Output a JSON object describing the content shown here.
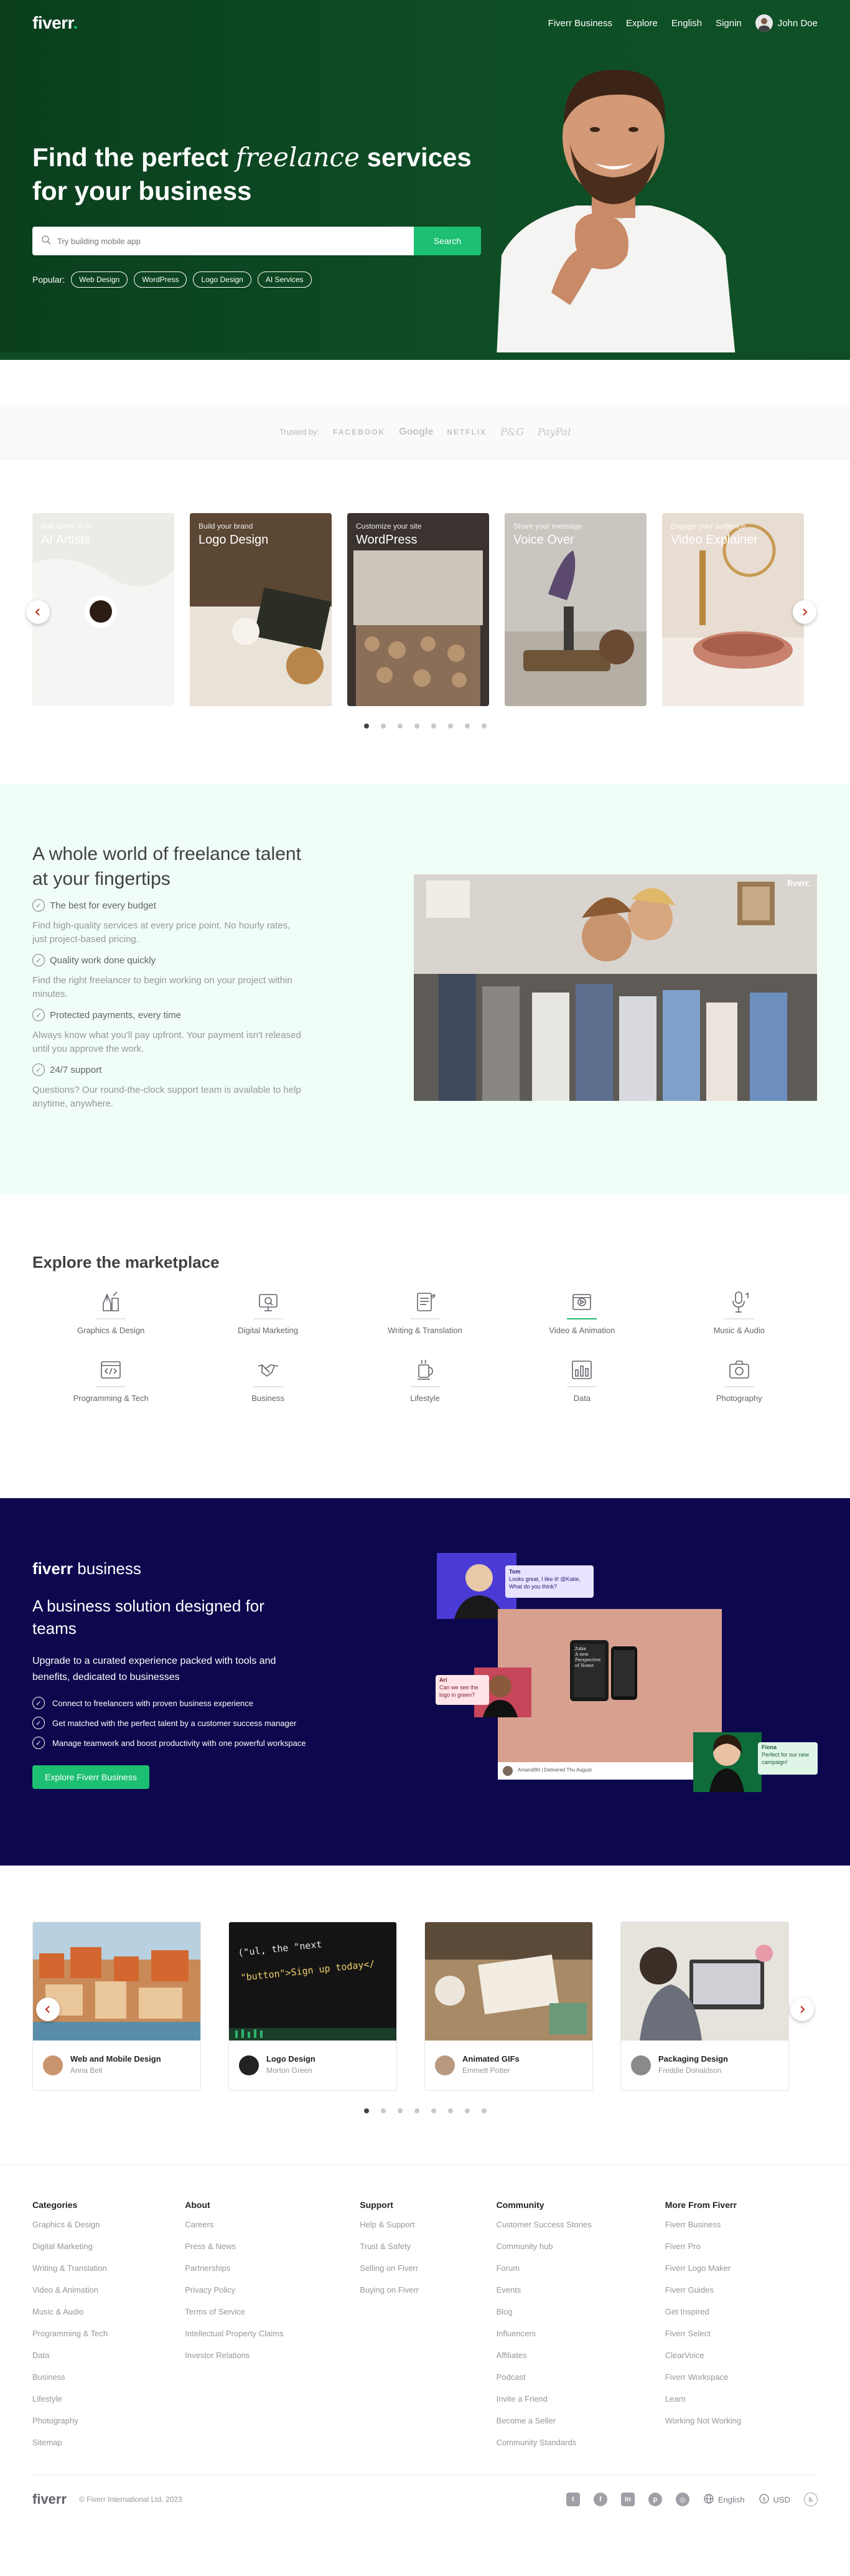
{
  "nav": {
    "logo": "fiverr",
    "logo_dot": ".",
    "links": [
      "Fiverr Business",
      "Explore",
      "English",
      "Signin"
    ],
    "user_name": "John Doe"
  },
  "hero": {
    "title_part1": "Find the perfect ",
    "title_italic": "freelance",
    "title_part2": " services for your business",
    "search_placeholder": "Try building mobile app",
    "search_button": "Search",
    "popular_label": "Popular:",
    "popular_tags": [
      "Web Design",
      "WordPress",
      "Logo Design",
      "AI Services"
    ]
  },
  "trusted": {
    "label": "Trusted by:",
    "brands": [
      "FACEBOOK",
      "Google",
      "NETFLIX",
      "P&G",
      "PayPal"
    ]
  },
  "services": {
    "cards": [
      {
        "sub": "Add talent to AI",
        "title": "AI Artists",
        "tone": "#e9e7e3"
      },
      {
        "sub": "Build your brand",
        "title": "Logo Design",
        "tone": "#8a6a4a"
      },
      {
        "sub": "Customize your site",
        "title": "WordPress",
        "tone": "#5b4a3e"
      },
      {
        "sub": "Share your message",
        "title": "Voice Over",
        "tone": "#bdb8b0"
      },
      {
        "sub": "Engage your audience",
        "title": "Video Explainer",
        "tone": "#d89a84"
      }
    ],
    "dots": 8,
    "active_dot": 0
  },
  "selling": {
    "title": "A whole world of freelance talent at your fingertips",
    "items": [
      {
        "title": "The best for every budget",
        "text": "Find high-quality services at every price point. No hourly rates, just project-based pricing."
      },
      {
        "title": "Quality work done quickly",
        "text": "Find the right freelancer to begin working on your project within minutes."
      },
      {
        "title": "Protected payments, every time",
        "text": "Always know what you'll pay upfront. Your payment isn't released until you approve the work."
      },
      {
        "title": "24/7 support",
        "text": "Questions? Our round-the-clock support team is available to help anytime, anywhere."
      }
    ],
    "video_logo": "fiverr."
  },
  "market": {
    "title": "Explore the marketplace",
    "items": [
      {
        "label": "Graphics & Design",
        "icon": "pen-tool-icon"
      },
      {
        "label": "Digital Marketing",
        "icon": "monitor-icon"
      },
      {
        "label": "Writing & Translation",
        "icon": "document-icon"
      },
      {
        "label": "Video & Animation",
        "icon": "film-icon"
      },
      {
        "label": "Music & Audio",
        "icon": "microphone-icon"
      },
      {
        "label": "Programming & Tech",
        "icon": "code-window-icon"
      },
      {
        "label": "Business",
        "icon": "handshake-icon"
      },
      {
        "label": "Lifestyle",
        "icon": "coffee-cup-icon"
      },
      {
        "label": "Data",
        "icon": "chart-icon"
      },
      {
        "label": "Photography",
        "icon": "camera-icon"
      }
    ],
    "active_index": 3
  },
  "business": {
    "brand": "fiverr",
    "brand_suffix": " business",
    "title": "A business solution designed for teams",
    "lead": "Upgrade to a curated experience packed with tools and benefits, dedicated to businesses",
    "items": [
      "Connect to freelancers with proven business experience",
      "Get matched with the perfect talent by a customer success manager",
      "Manage teamwork and boost productivity with one powerful workspace"
    ],
    "button": "Explore Fiverr Business",
    "bubble1": "Looks great, I like it! @Katie, What do you think?",
    "bubble1_name": "Tom",
    "bubble2": "Can we see the logo in green?",
    "bubble2_name": "Ari",
    "bubble3": "Perfect for our new campaign!",
    "bubble3_name": "Fiona",
    "mockup_title": "A new Perspective of Home",
    "mockup_brand": "Zubia",
    "mockup_footer": "Amandi90 | Delivered Thu August"
  },
  "projects": {
    "cards": [
      {
        "title": "Web and Mobile Design",
        "author": "Anna Bell",
        "tone": "#c06c3a"
      },
      {
        "title": "Logo Design",
        "author": "Morton Green",
        "tone": "#1a1a1a"
      },
      {
        "title": "Animated GIFs",
        "author": "Emmett Potter",
        "tone": "#8a6f52"
      },
      {
        "title": "Packaging Design",
        "author": "Freddie Donaldson",
        "tone": "#d8d3cc"
      }
    ],
    "code_line1": "(\"ul, the \"next",
    "code_line2": "\"button\">Sign up today</",
    "dots": 8,
    "active_dot": 0
  },
  "footer": {
    "columns": [
      {
        "title": "Categories",
        "links": [
          "Graphics & Design",
          "Digital Marketing",
          "Writing & Translation",
          "Video & Animation",
          "Music & Audio",
          "Programming & Tech",
          "Data",
          "Business",
          "Lifestyle",
          "Photography",
          "Sitemap"
        ]
      },
      {
        "title": "About",
        "links": [
          "Careers",
          "Press & News",
          "Partnerships",
          "Privacy Policy",
          "Terms of Service",
          "Intellectual Property Claims",
          "Investor Relations"
        ]
      },
      {
        "title": "Support",
        "links": [
          "Help & Support",
          "Trust & Safety",
          "Selling on Fiverr",
          "Buying on Fiverr"
        ]
      },
      {
        "title": "Community",
        "links": [
          "Customer Success Stories",
          "Community hub",
          "Forum",
          "Events",
          "Blog",
          "Influencers",
          "Affiliates",
          "Podcast",
          "Invite a Friend",
          "Become a Seller",
          "Community Standards"
        ]
      },
      {
        "title": "More From Fiverr",
        "links": [
          "Fiverr Business",
          "Fiverr Pro",
          "Fiverr Logo Maker",
          "Fiverr Guides",
          "Get Inspired",
          "Fiverr Select",
          "ClearVoice",
          "Fiverr Workspace",
          "Learn",
          "Working Not Working"
        ]
      }
    ],
    "logo": "fiverr",
    "copyright": "© Fiverr International Ltd. 2023",
    "language": "English",
    "currency": "USD",
    "social": [
      "twitter-icon",
      "facebook-icon",
      "linkedin-icon",
      "pinterest-icon",
      "instagram-icon"
    ]
  }
}
